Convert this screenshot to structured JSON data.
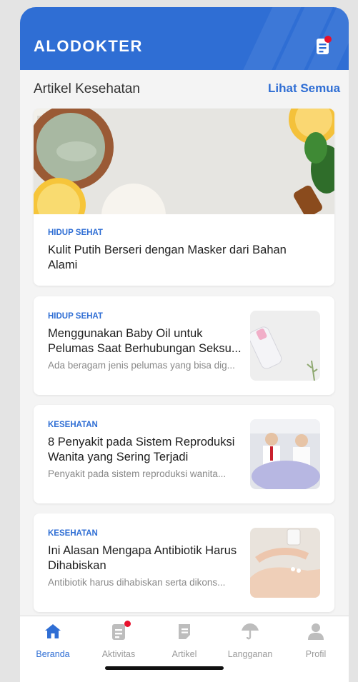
{
  "header": {
    "brand": "ALODOKTER",
    "icon": "notes-notification-icon"
  },
  "section": {
    "title": "Artikel Kesehatan",
    "see_all": "Lihat Semua"
  },
  "featured": {
    "category": "HIDUP SEHAT",
    "title": "Kulit Putih Berseri dengan Masker dari Bahan Alami"
  },
  "articles": [
    {
      "category": "HIDUP SEHAT",
      "title": "Menggunakan Baby Oil untuk Pelumas Saat Berhubungan Seksu...",
      "excerpt": "Ada beragam jenis pelumas yang bisa dig..."
    },
    {
      "category": "KESEHATAN",
      "title": "8 Penyakit pada Sistem Reproduksi Wanita yang Sering Terjadi",
      "excerpt": "Penyakit pada sistem reproduksi wanita..."
    },
    {
      "category": "KESEHATAN",
      "title": "Ini Alasan Mengapa Antibiotik Harus Dihabiskan",
      "excerpt": "Antibiotik harus dihabiskan serta dikons..."
    }
  ],
  "tabs": [
    {
      "label": "Beranda",
      "icon": "home-icon",
      "active": true
    },
    {
      "label": "Aktivitas",
      "icon": "activity-icon",
      "badge": true
    },
    {
      "label": "Artikel",
      "icon": "article-icon"
    },
    {
      "label": "Langganan",
      "icon": "umbrella-icon"
    },
    {
      "label": "Profil",
      "icon": "profile-icon"
    }
  ],
  "colors": {
    "primary": "#2f6ed4",
    "badge": "#e8112d",
    "inactive": "#bdbdbd"
  }
}
